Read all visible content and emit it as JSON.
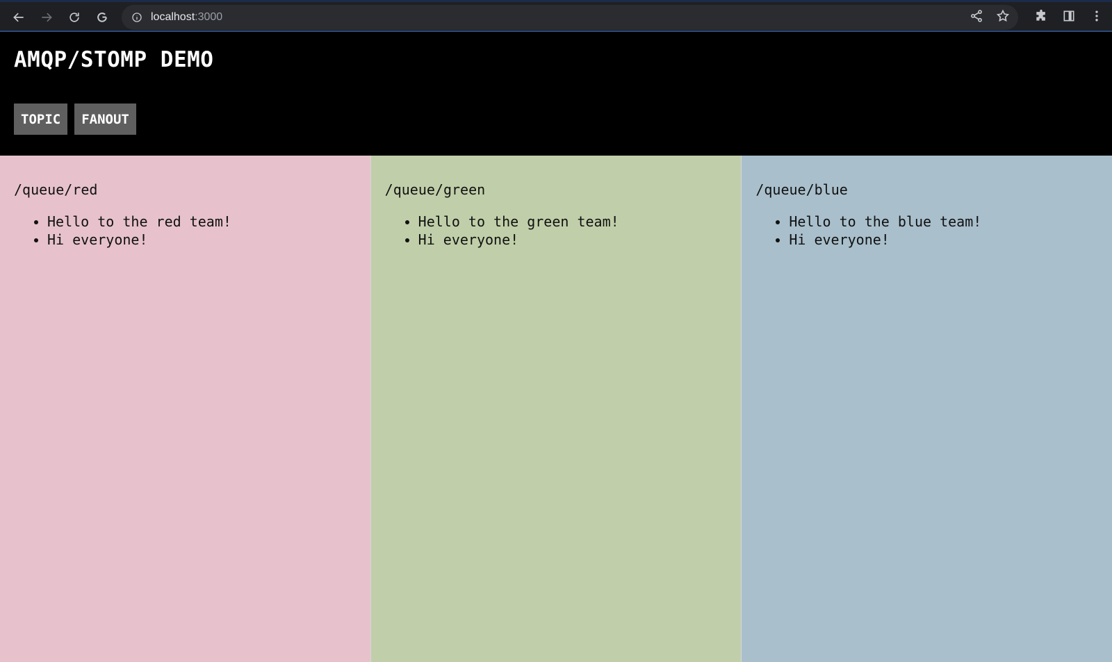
{
  "browser": {
    "url_host": "localhost",
    "url_port": ":3000"
  },
  "app": {
    "title": "AMQP/STOMP DEMO",
    "buttons": [
      "TOPIC",
      "FANOUT"
    ]
  },
  "queues": [
    {
      "name": "/queue/red",
      "color": "#e7c2cc",
      "messages": [
        "Hello to the red team!",
        "Hi everyone!"
      ]
    },
    {
      "name": "/queue/green",
      "color": "#c0cfa9",
      "messages": [
        "Hello to the green team!",
        "Hi everyone!"
      ]
    },
    {
      "name": "/queue/blue",
      "color": "#a9bfcc",
      "messages": [
        "Hello to the blue team!",
        "Hi everyone!"
      ]
    }
  ]
}
